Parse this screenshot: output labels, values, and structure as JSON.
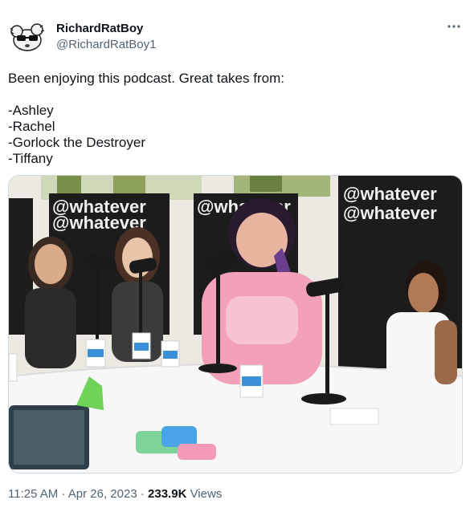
{
  "author": {
    "display_name": "RichardRatBoy",
    "handle": "@RichardRatBoy1",
    "avatar_icon": "rat-with-sunglasses-icon"
  },
  "more_icon": "more-horizontal-icon",
  "tweet": {
    "intro": "Been enjoying this podcast. Great takes from:",
    "names": [
      "-Ashley",
      "-Rachel",
      "-Gorlock the Destroyer",
      "-Tiffany"
    ]
  },
  "media": {
    "backdrop_text": [
      "@whatever",
      "@whatever",
      "@whatever",
      "@whatever",
      "@whatever"
    ]
  },
  "meta": {
    "time": "11:25 AM",
    "separator": "·",
    "date": "Apr 26, 2023",
    "views_count": "233.9K",
    "views_label": "Views"
  }
}
